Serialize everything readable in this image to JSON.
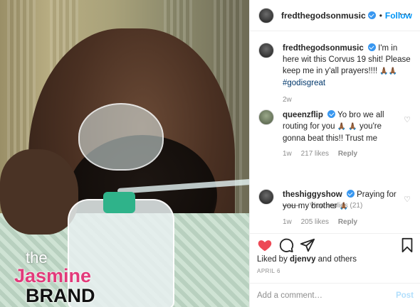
{
  "watermark": {
    "line1": "the",
    "line2": "Jasmine",
    "line3": "BRAND"
  },
  "header": {
    "username": "fredthegodsonmusic",
    "separator": "•",
    "follow_label": "Follow",
    "more_label": "···"
  },
  "caption": {
    "username": "fredthegodsonmusic",
    "text": "I'm in here wit this Corvus 19 shit! Please keep me in y'all prayers!!!! ",
    "emoji": "🙏🏾🙏🏾",
    "hashtag": "#godisgreat",
    "time": "2w"
  },
  "comments": [
    {
      "username": "queenzflip",
      "text": "Yo bro we all routing for you ",
      "emoji1": "🙏🏾",
      "mid": " ",
      "emoji2": "🙏🏾",
      "text2": " you're gonna beat this!! Trust me",
      "time": "1w",
      "likes": "217 likes",
      "reply": "Reply"
    },
    {
      "username": "theshiggyshow",
      "text": "Praying for you my brother ",
      "emoji1": "🙏🏾",
      "time": "1w",
      "likes": "205 likes",
      "reply": "Reply"
    }
  ],
  "view_replies": "View replies (21)",
  "actions": {
    "liked_prefix": "Liked by ",
    "liked_user": "djenvy",
    "liked_suffix": " and others",
    "date": "APRIL 6"
  },
  "add_comment": {
    "placeholder": "Add a comment…",
    "post_label": "Post"
  },
  "colors": {
    "accent": "#0095f6",
    "like_red": "#ed4956",
    "verified": "#3897f0",
    "watermark_pink": "#e23a7a"
  }
}
